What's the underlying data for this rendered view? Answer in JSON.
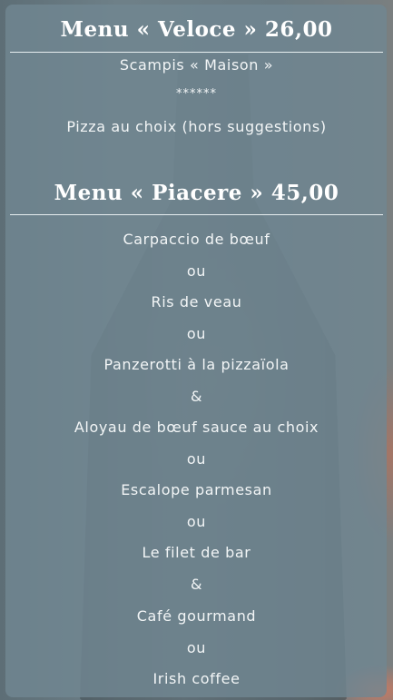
{
  "menu_veloce": {
    "title": "Menu « Veloce » 26,00",
    "items": [
      "Scampis « Maison »",
      "******",
      "Pizza au choix (hors suggestions)"
    ]
  },
  "menu_piacere": {
    "title": "Menu « Piacere » 45,00",
    "items": [
      "Carpaccio de bœuf",
      "ou",
      "Ris de veau",
      "ou",
      "Panzerotti à la pizzaïola",
      "&",
      "Aloyau de bœuf sauce au choix",
      "ou",
      "Escalope parmesan",
      "ou",
      "Le filet de bar",
      "&",
      "Café gourmand",
      "ou",
      "Irish coffee"
    ]
  }
}
